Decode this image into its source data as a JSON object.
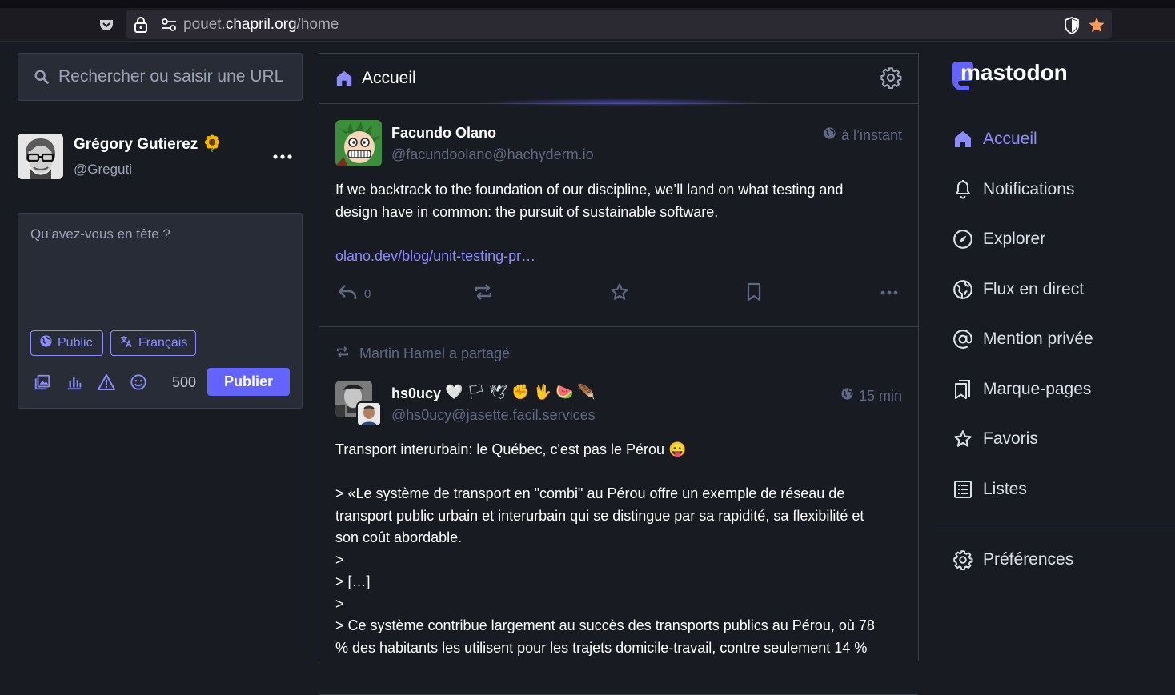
{
  "browser": {
    "url_host_prefix": "pouet.",
    "url_host": "chapril.org",
    "url_path": "/home"
  },
  "search": {
    "placeholder": "Rechercher ou saisir une URL"
  },
  "account": {
    "display_name": "Grégory Gutierez",
    "emoji": "🌻",
    "handle": "@Greguti"
  },
  "composer": {
    "placeholder": "Qu’avez-vous en tête ?",
    "visibility_label": "Public",
    "language_label": "Français",
    "char_count": "500",
    "publish_label": "Publier"
  },
  "column": {
    "title": "Accueil"
  },
  "posts": [
    {
      "display_name": "Facundo Olano",
      "handle": "@facundoolano@hachyderm.io",
      "time": "à l’instant",
      "content_line1": "If we backtrack to the foundation of our discipline, we’ll land on what testing and",
      "content_line2": "design have in common: the pursuit of sustainable software.",
      "link": "olano.dev/blog/unit-testing-pr…",
      "reply_count": "0"
    },
    {
      "reblogged_by": "Martin Hamel a partagé",
      "display_name": "hs0ucy",
      "name_emojis": "🤍 🏳 🕊 ✊ 🖖 🍉 🪶",
      "handle": "@hs0ucy@jasette.facil.services",
      "time": "15 min",
      "line1": "Transport interurbain: le Québec, c'est pas le Pérou",
      "line1_emoji": "😛",
      "line2": "> «Le système de transport en \"combi\" au Pérou offre un exemple de réseau de",
      "line3": "transport public urbain et interurbain qui se distingue par sa rapidité, sa flexibilité et",
      "line4": "son coût abordable.",
      "line5": ">",
      "line6": "> […]",
      "line7": ">",
      "line8": "> Ce système contribue largement au succès des transports publics au Pérou, où 78",
      "line9": "% des habitants les utilisent pour les trajets domicile-travail, contre seulement 14 %"
    }
  ],
  "nav": {
    "logo_text": "mastodon",
    "items": [
      {
        "label": "Accueil",
        "icon": "home-icon"
      },
      {
        "label": "Notifications",
        "icon": "bell-icon"
      },
      {
        "label": "Explorer",
        "icon": "compass-icon"
      },
      {
        "label": "Flux en direct",
        "icon": "globe-icon"
      },
      {
        "label": "Mention privée",
        "icon": "at-icon"
      },
      {
        "label": "Marque-pages",
        "icon": "bookmarks-icon"
      },
      {
        "label": "Favoris",
        "icon": "star-icon"
      },
      {
        "label": "Listes",
        "icon": "list-icon"
      }
    ],
    "preferences": "Préférences"
  },
  "colors": {
    "accent": "#6364ff",
    "accent_light": "#8c8dff",
    "background": "#191b22",
    "panel": "#282c37",
    "muted": "#606984"
  }
}
